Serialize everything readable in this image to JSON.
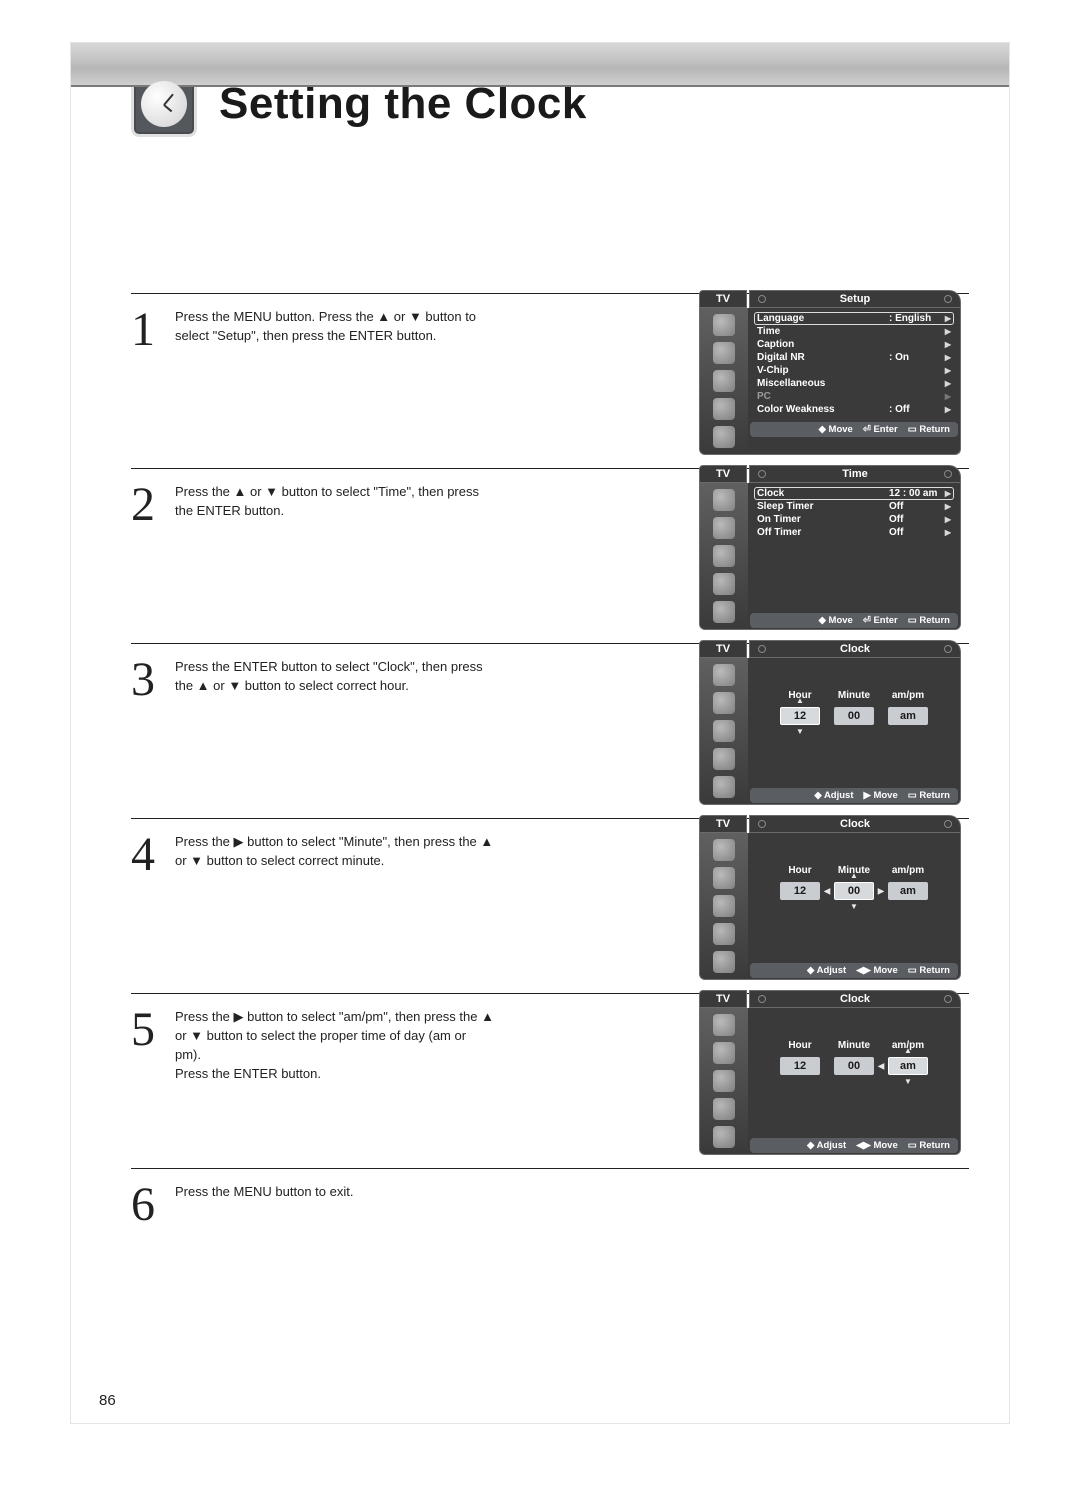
{
  "page": {
    "title": "Setting the Clock",
    "number": "86"
  },
  "steps": [
    {
      "num": "1",
      "text": "Press the MENU button. Press the ▲ or ▼ button to select \"Setup\", then press the ENTER button."
    },
    {
      "num": "2",
      "text": "Press the ▲ or ▼ button to select \"Time\", then press the ENTER button."
    },
    {
      "num": "3",
      "text": "Press the ENTER button to select \"Clock\", then press the ▲ or ▼ button to select correct hour."
    },
    {
      "num": "4",
      "text": "Press the ▶ button to select \"Minute\", then press the ▲ or ▼ button to select correct minute."
    },
    {
      "num": "5",
      "text": "Press the ▶ button to select \"am/pm\", then press the ▲ or ▼ button to select the proper time of day (am or pm).\nPress the ENTER button."
    },
    {
      "num": "6",
      "text": "Press the MENU button to exit."
    }
  ],
  "osd": {
    "tv_label": "TV",
    "setup": {
      "title": "Setup",
      "rows": [
        {
          "label": "Language",
          "value": ": English",
          "selected": true
        },
        {
          "label": "Time",
          "value": ""
        },
        {
          "label": "Caption",
          "value": ""
        },
        {
          "label": "Digital NR",
          "value": ": On"
        },
        {
          "label": "V-Chip",
          "value": ""
        },
        {
          "label": "Miscellaneous",
          "value": ""
        },
        {
          "label": "PC",
          "value": "",
          "dim": true
        },
        {
          "label": "Color Weakness",
          "value": ": Off"
        }
      ],
      "legend": {
        "a": "Move",
        "b": "Enter",
        "c": "Return"
      }
    },
    "time": {
      "title": "Time",
      "rows": [
        {
          "label": "Clock",
          "value": "12 : 00 am",
          "selected": true
        },
        {
          "label": "Sleep Timer",
          "value": "Off"
        },
        {
          "label": "On Timer",
          "value": "Off"
        },
        {
          "label": "Off Timer",
          "value": "Off"
        }
      ],
      "legend": {
        "a": "Move",
        "b": "Enter",
        "c": "Return"
      }
    },
    "clock": {
      "title": "Clock",
      "headers": {
        "hour": "Hour",
        "minute": "Minute",
        "ampm": "am/pm"
      },
      "values": {
        "hour": "12",
        "minute": "00",
        "ampm": "am"
      },
      "legend_adjust": {
        "a": "Adjust",
        "b": "Move",
        "c": "Return"
      }
    }
  }
}
